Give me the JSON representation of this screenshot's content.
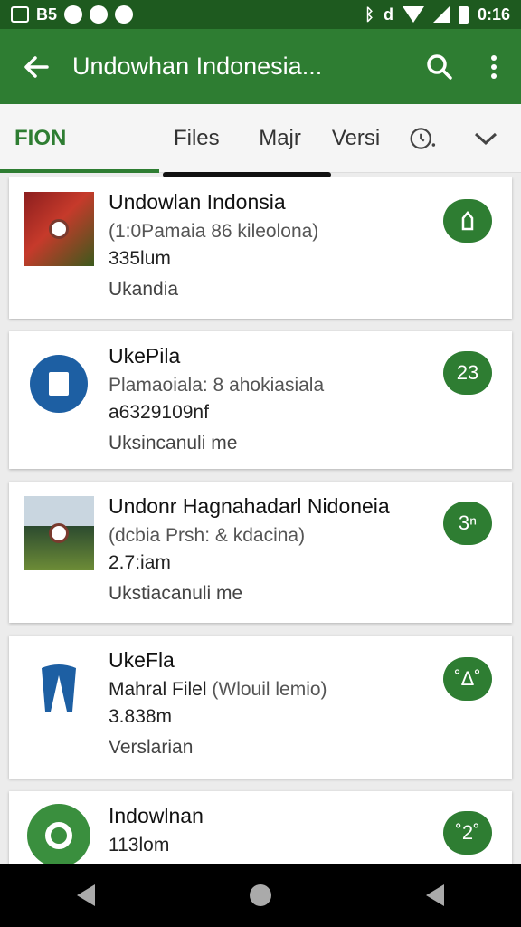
{
  "status": {
    "left_label": "B5",
    "time": "0:16",
    "carrier_glyph": "d",
    "icons": [
      "square-icon",
      "alarm-icon",
      "chat-icon",
      "pin-icon",
      "bluetooth-icon",
      "wifi-icon",
      "signal-icon",
      "battery-icon"
    ]
  },
  "app_bar": {
    "title": "Undowhan Indonesia...",
    "back_icon": "arrow-left-icon",
    "search_icon": "search-icon",
    "menu_icon": "more-vert-icon",
    "color": "#2e7d32"
  },
  "tabs": [
    {
      "label": "FION",
      "active": true
    },
    {
      "label": "Files",
      "active": false
    },
    {
      "label": "Majr",
      "active": false
    },
    {
      "label": "Versi",
      "active": false
    },
    {
      "label": "",
      "icon": "history-icon",
      "active": false
    }
  ],
  "items": [
    {
      "title": "Undowlan Indonsia",
      "subtitle": "(1:0Pamaia 86 kileolona)",
      "size": "335lum",
      "meta": "Ukandia",
      "badge": "",
      "badge_icon": "download-icon",
      "thumb": "food-photo"
    },
    {
      "title": "UkePila",
      "subtitle": "Plamaoiala: 8 ahokiasiala",
      "extra": "a6329109nf",
      "meta": "Uksincanuli me",
      "badge": "23",
      "thumb": "document-icon"
    },
    {
      "title": "Undonr Hagnahadarl Nidoneia",
      "subtitle": "(dcbia Prsh: & kdacina)",
      "size": "2.7:iam",
      "meta": "Ukstiacanuli me",
      "badge": "3ⁿ",
      "thumb": "house-photo"
    },
    {
      "title": "UkeFla",
      "subtitle_main": "Mahral Filel",
      "subtitle": "(Wlouil lemio)",
      "size": "3.838m",
      "meta": "Verslarian",
      "badge": "˚Δ˚",
      "thumb": "app-logo-icon"
    },
    {
      "title": "Indowlnan",
      "size": "113lom",
      "badge": "˚2˚",
      "thumb": "lens-icon"
    }
  ],
  "nav": {
    "back_icon": "nav-back-icon",
    "home_icon": "nav-home-icon",
    "recents_icon": "nav-recents-icon"
  }
}
